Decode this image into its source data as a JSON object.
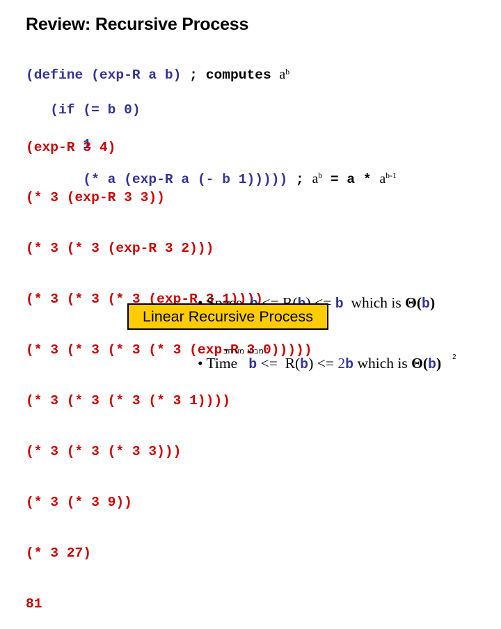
{
  "slide": {
    "title": "Review: Recursive Process",
    "code": {
      "line1_code": "(define (exp-R a b) ",
      "line1_comment": "; computes ",
      "line1_a": "a",
      "line1_sup": "b",
      "line2": "   (if (= b 0)",
      "line3": "       1",
      "line4_code": "       (* a (exp-R a (- b 1))))) ",
      "line4_comment_semi": "; ",
      "line4_a1": "a",
      "line4_sup1": "b",
      "line4_eq": " = a * ",
      "line4_a2": "a",
      "line4_sup2": "b-1"
    },
    "trace": [
      "(exp-R 3 4)",
      "(* 3 (exp-R 3 3))",
      "(* 3 (* 3 (exp-R 3 2)))",
      "(* 3 (* 3 (* 3 (exp-R 3 1))))",
      "(* 3 (* 3 (* 3 (* 3 (exp-R 3 0)))))",
      "(* 3 (* 3 (* 3 (* 3 1))))",
      "(* 3 (* 3 (* 3 3)))",
      "(* 3 (* 3 9))",
      "(* 3 27)",
      "81"
    ],
    "bullets": {
      "space": {
        "bullet": "• ",
        "label": "Space  ",
        "b1": "b",
        "op1": " <= R(",
        "b2": "b",
        "op2": ") <= ",
        "b3": "b",
        "tail": "  which is ",
        "theta": "Θ(",
        "b4": "b",
        "close": ")"
      },
      "time": {
        "bullet": "• ",
        "label": "Time   ",
        "b1": "b",
        "op1": " <=  R(",
        "b2": "b",
        "op2": ") <= ",
        "two": "2",
        "b3": "b",
        "tail": " which is ",
        "theta": "Θ(",
        "b4": "b",
        "close": ")"
      }
    },
    "highlight_box": "Linear Recursive Process",
    "footer": "מבוא מורחב",
    "page_number": "2",
    "colors": {
      "code": "#333399",
      "trace": "#cc0000",
      "box_fill": "#ffcc00"
    }
  }
}
